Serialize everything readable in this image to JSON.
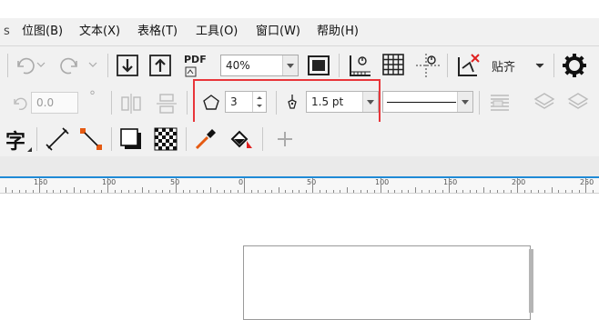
{
  "menu": {
    "items": [
      {
        "label": "位图(B)"
      },
      {
        "label": "文本(X)"
      },
      {
        "label": "表格(T)"
      },
      {
        "label": "工具(O)"
      },
      {
        "label": "窗口(W)"
      },
      {
        "label": "帮助(H)"
      }
    ]
  },
  "toolbar_standard": {
    "pdf_label": "PDF",
    "zoom_value": "40%",
    "snap_label": "贴齐"
  },
  "property_bar": {
    "rotation_value": "0.0",
    "rotation_degree": "°",
    "polygon_sides": "3",
    "outline_width": "1.5 pt"
  },
  "toolbox": {
    "text_glyph": "字"
  },
  "ruler": {
    "labels": [
      "150",
      "100",
      "50",
      "0",
      "50",
      "100",
      "150",
      "200",
      "250"
    ]
  },
  "colors": {
    "accent_blue": "#1f8ad6",
    "highlight_red": "#e8353a",
    "toolbar_bg": "#f1f1f1"
  }
}
